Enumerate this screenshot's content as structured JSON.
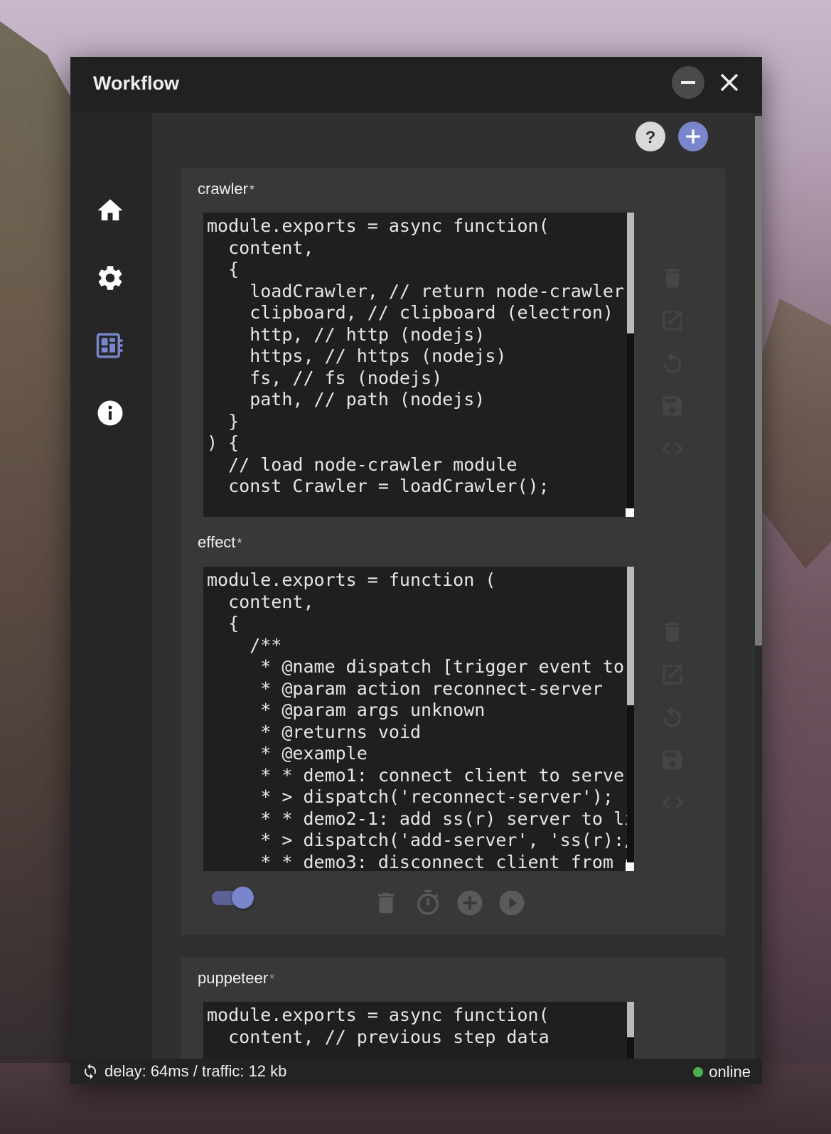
{
  "window": {
    "title": "Workflow"
  },
  "colors": {
    "accent": "#7986cb",
    "online": "#4caf50",
    "text": "#eeeeee"
  },
  "sidebar": {
    "items": [
      {
        "name": "home",
        "icon": "home-icon"
      },
      {
        "name": "settings",
        "icon": "gear-icon"
      },
      {
        "name": "workflow",
        "icon": "dashboard-icon",
        "active": true
      },
      {
        "name": "info",
        "icon": "info-icon"
      }
    ]
  },
  "toolbar": {
    "help_icon": "help-icon",
    "add_icon": "add-icon"
  },
  "cards": [
    {
      "blocks": [
        {
          "label": "crawler",
          "star": "*",
          "code": "module.exports = async function(\n  content,\n  {\n    loadCrawler, // return node-crawler\n    clipboard, // clipboard (electron)\n    http, // http (nodejs)\n    https, // https (nodejs)\n    fs, // fs (nodejs)\n    path, // path (nodejs)\n  }\n) {\n  // load node-crawler module\n  const Crawler = loadCrawler();"
        },
        {
          "label": "effect",
          "star": "*",
          "code": "module.exports = function (\n  content,\n  {\n    /**\n     * @name dispatch [trigger event to main]\n     * @param action reconnect-server\n     * @param args unknown\n     * @returns void\n     * @example\n     * * demo1: connect client to server\n     * > dispatch('reconnect-server');\n     * * demo2-1: add ss(r) server to list\n     * > dispatch('add-server', 'ss(r)://...');\n     * * demo3: disconnect client from server"
        }
      ],
      "enabled": true
    },
    {
      "blocks": [
        {
          "label": "puppeteer",
          "star": "*",
          "code": "module.exports = async function(\n  content, // previous step data"
        }
      ]
    }
  ],
  "status": {
    "left": "delay: 64ms / traffic: 12 kb",
    "right": "online"
  }
}
